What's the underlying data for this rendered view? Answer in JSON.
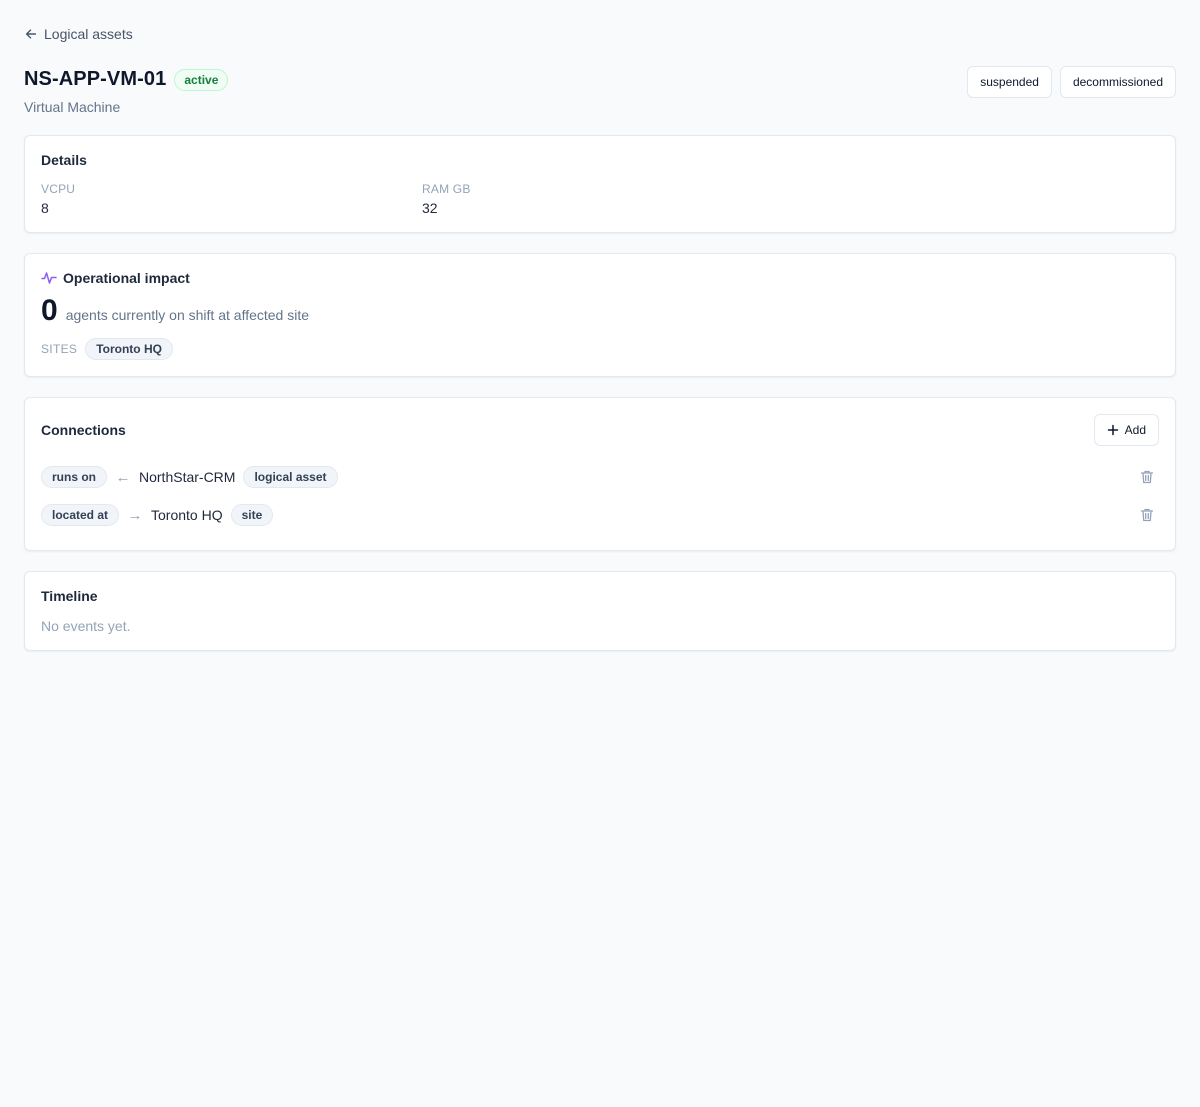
{
  "nav": {
    "back_label": "Logical assets"
  },
  "asset": {
    "name": "NS-APP-VM-01",
    "status": "active",
    "type": "Virtual Machine"
  },
  "actions": {
    "suspend_label": "suspended",
    "decommission_label": "decommissioned"
  },
  "details": {
    "title": "Details",
    "fields": [
      {
        "label": "VCPU",
        "value": "8"
      },
      {
        "label": "RAM GB",
        "value": "32"
      }
    ]
  },
  "impact": {
    "title": "Operational impact",
    "count": "0",
    "description": "agents currently on shift at affected site",
    "sites_label": "SITES",
    "sites": [
      "Toronto HQ"
    ]
  },
  "connections": {
    "title": "Connections",
    "add_label": "Add",
    "items": [
      {
        "relation": "runs on",
        "arrow": "←",
        "target": "NorthStar-CRM",
        "kind": "logical asset"
      },
      {
        "relation": "located at",
        "arrow": "→",
        "target": "Toronto HQ",
        "kind": "site"
      }
    ]
  },
  "timeline": {
    "title": "Timeline",
    "empty": "No events yet."
  },
  "icons": {
    "back": "arrow-left-icon",
    "impact": "activity-icon",
    "add": "plus-icon",
    "delete": "trash-icon"
  },
  "colors": {
    "status_active": "#15803d",
    "impact_icon": "#8b5cf6"
  }
}
